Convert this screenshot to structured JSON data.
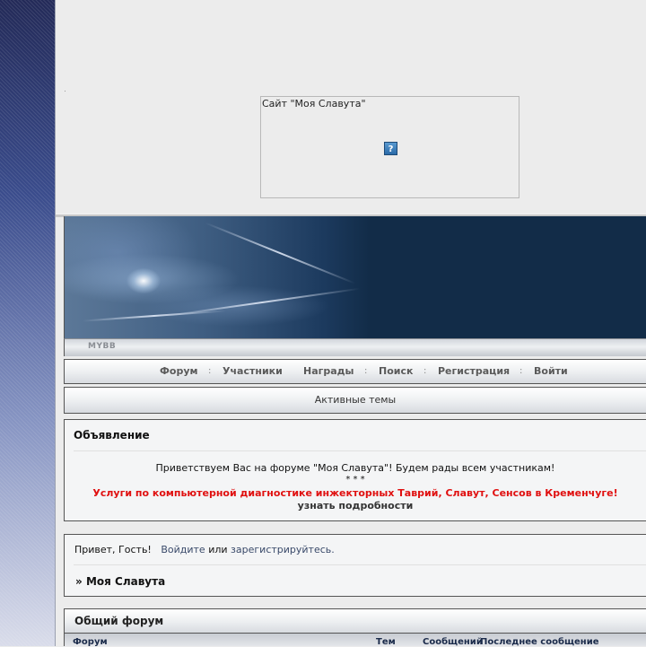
{
  "ad": {
    "title": "Сайт \"Моя Славута\"",
    "icon": "?"
  },
  "banner": {
    "logo_text": "MYBB"
  },
  "nav": {
    "items": [
      "Форум",
      "Участники",
      "Награды",
      "Поиск",
      "Регистрация",
      "Войти"
    ],
    "separators": [
      ":",
      ":",
      ":",
      ":"
    ]
  },
  "active_topics": "Активные темы",
  "announcement": {
    "heading": "Объявление",
    "welcome": "Приветствуем Вас на форуме \"Моя Славута\"! Будем рады всем участникам!",
    "stars": "* * *",
    "promo": "Услуги по компьютерной диагностике инжекторных Таврий, Славут, Сенсов в Кременчуге!",
    "details_link": "узнать подробности"
  },
  "welcome": {
    "greeting": "Привет, Гость!",
    "login_link": "Войдите",
    "or_text": "или",
    "register_link": "зарегистрируйтесь.",
    "crumb_prefix": "»",
    "crumb_title": "Моя Славута"
  },
  "forum_section": {
    "title": "Общий форум",
    "columns": [
      "Форум",
      "Тем",
      "Сообщений",
      "Последнее сообщение"
    ]
  }
}
